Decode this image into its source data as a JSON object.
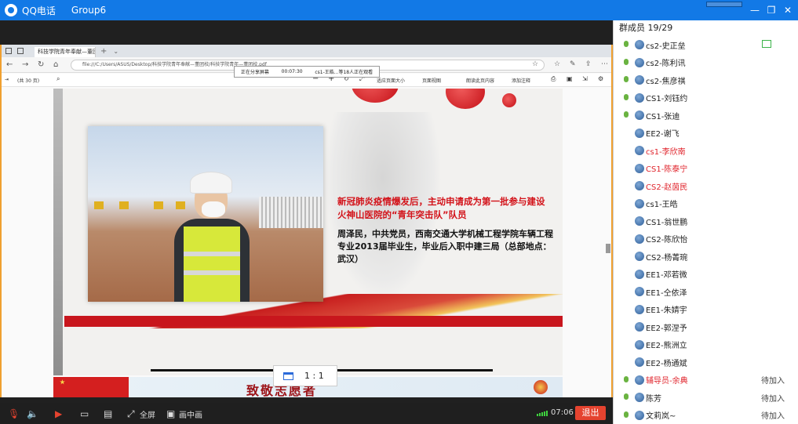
{
  "window": {
    "app_name": "QQ电话",
    "group_name": "Group6"
  },
  "share_bar": {
    "status": "正在分享屏幕",
    "time": "00:07:30",
    "viewers": "cs1-王皓...等18人正在观看"
  },
  "browser": {
    "tab_title": "科技学院青年奉献—董团校",
    "address": "file:///C:/Users/ASUS/Desktop/科技学院青年奉献—董团校/科技学院青年—董团校.pdf",
    "page_indicator": "(共 30 页)",
    "pdf_tools": [
      "适应页面大小",
      "页面视图",
      "朗读此页内容",
      "添加注释"
    ]
  },
  "slide": {
    "headline": "新冠肺炎疫情爆发后，主动申请成为第一批参与建设火神山医院的“青年突击队”队员",
    "body": "周泽民，中共党员，西南交通大学机械工程学院车辆工程专业2013届毕业生，毕业后入职中建三局（总部地点：武汉）",
    "next_title": "致敬志愿者"
  },
  "ratio_popup": {
    "label": "1 : 1"
  },
  "toolbar": {
    "fullscreen": "全屏",
    "pip": "画中画",
    "time": "07:06",
    "exit": "退出"
  },
  "members": {
    "header": "群成员 19/29",
    "list": [
      {
        "name": "cs2-史正垒",
        "red": false,
        "status": "",
        "mic": true,
        "screen": true
      },
      {
        "name": "cs2-陈利讯",
        "red": false,
        "status": "",
        "mic": true,
        "screen": false
      },
      {
        "name": "cs2-焦彦祺",
        "red": false,
        "status": "",
        "mic": true,
        "screen": false
      },
      {
        "name": "CS1-刘钰约",
        "red": false,
        "status": "",
        "mic": true,
        "screen": false
      },
      {
        "name": "CS1-张迪",
        "red": false,
        "status": "",
        "mic": true,
        "screen": false
      },
      {
        "name": "EE2-谢飞",
        "red": false,
        "status": "",
        "mic": false,
        "screen": false
      },
      {
        "name": "cs1-李欣南",
        "red": true,
        "status": "",
        "mic": false,
        "screen": false
      },
      {
        "name": "CS1-陈泰宁",
        "red": true,
        "status": "",
        "mic": false,
        "screen": false
      },
      {
        "name": "CS2-赵茵民",
        "red": true,
        "status": "",
        "mic": false,
        "screen": false
      },
      {
        "name": "cs1-王皓",
        "red": false,
        "status": "",
        "mic": false,
        "screen": false
      },
      {
        "name": "CS1-翁世鹏",
        "red": false,
        "status": "",
        "mic": false,
        "screen": false
      },
      {
        "name": "CS2-陈欣怡",
        "red": false,
        "status": "",
        "mic": false,
        "screen": false
      },
      {
        "name": "CS2-杨菁琬",
        "red": false,
        "status": "",
        "mic": false,
        "screen": false
      },
      {
        "name": "EE1-邓若微",
        "red": false,
        "status": "",
        "mic": false,
        "screen": false
      },
      {
        "name": "EE1-仝依泽",
        "red": false,
        "status": "",
        "mic": false,
        "screen": false
      },
      {
        "name": "EE1-朱婧宇",
        "red": false,
        "status": "",
        "mic": false,
        "screen": false
      },
      {
        "name": "EE2-郭涅予",
        "red": false,
        "status": "",
        "mic": false,
        "screen": false
      },
      {
        "name": "EE2-熊洲立",
        "red": false,
        "status": "",
        "mic": false,
        "screen": false
      },
      {
        "name": "EE2-杨通斌",
        "red": false,
        "status": "",
        "mic": false,
        "screen": false
      },
      {
        "name": "辅导员-余典",
        "red": true,
        "status": "待加入",
        "mic": true,
        "screen": false
      },
      {
        "name": "陈芳",
        "red": false,
        "status": "待加入",
        "mic": true,
        "screen": false
      },
      {
        "name": "文莉岚~",
        "red": false,
        "status": "待加入",
        "mic": true,
        "screen": false
      }
    ]
  }
}
